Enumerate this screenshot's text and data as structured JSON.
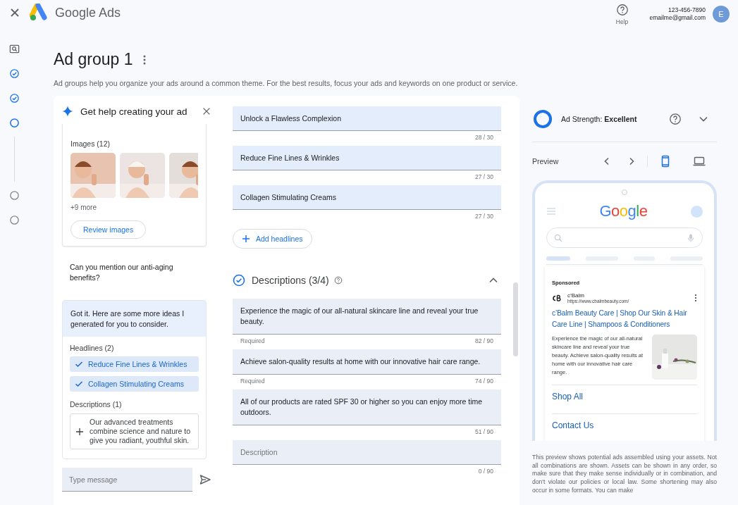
{
  "top_bar": {
    "product": "Google Ads",
    "help": "Help",
    "phone": "123-456-7890",
    "email": "emailme@gmail.com",
    "avatar": "E"
  },
  "steps": [
    {
      "kind": "preview"
    },
    {
      "kind": "done"
    },
    {
      "kind": "done"
    },
    {
      "kind": "current"
    },
    {
      "kind": "todo"
    },
    {
      "kind": "todo"
    }
  ],
  "page": {
    "title": "Ad group 1",
    "description": "Ad groups help you organize your ads around a common theme. For the best results, focus your ads and keywords on one product or service."
  },
  "assistant": {
    "title": "Get help creating your ad",
    "images_label": "Images (12)",
    "images": [
      {
        "kind": "picture"
      },
      {
        "kind": "picture"
      },
      {
        "kind": "picture"
      }
    ],
    "more": "+9 more",
    "review_button": "Review images",
    "user_message": "Can you mention our anti-aging benefits?",
    "reply": {
      "text": "Got it. Here are some more ideas I generated for you to consider.",
      "headlines_label": "Headlines (2)",
      "headlines": [
        {
          "text": "Reduce Fine Lines & Wrinkles",
          "checked": true
        },
        {
          "text": "Collagen Stimulating Creams",
          "checked": true
        }
      ],
      "descriptions_label": "Descriptions (1)",
      "descriptions": [
        {
          "text": "Our advanced treatments combine science and nature to give you radiant, youthful skin.",
          "added": false
        }
      ]
    },
    "input": {
      "placeholder": "Type message"
    }
  },
  "headlines": [
    {
      "value": "Unlock a Flawless Complexion",
      "counter": "28 / 30"
    },
    {
      "value": "Reduce Fine Lines & Wrinkles",
      "counter": "27 / 30"
    },
    {
      "value": "Collagen Stimulating Creams",
      "counter": "27 / 30"
    }
  ],
  "add_headlines": "Add headlines",
  "descriptions_section": {
    "title": "Descriptions (3/4)",
    "complete": true,
    "expanded": true,
    "fields": [
      {
        "value": "Experience the magic of our all-natural skincare line and reveal your true beauty.",
        "helper": "Required",
        "counter": "82 / 90"
      },
      {
        "value": "Achieve salon-quality results at home with our innovative hair care range.",
        "helper": "Required",
        "counter": "74 / 90"
      },
      {
        "value": "All of our products are rated SPF 30 or higher so you can enjoy more time outdoors.",
        "counter": "51 / 90"
      },
      {
        "placeholder": "Description",
        "counter": "0 / 90"
      }
    ]
  },
  "ad_strength": {
    "label": "Ad Strength: **Excellent**",
    "level": 1
  },
  "preview": {
    "label": "Preview",
    "devices": [
      {
        "kind": "mobile",
        "selected": true
      },
      {
        "kind": "desktop",
        "selected": false
      }
    ],
    "search_logo": "Google",
    "ad": {
      "sponsored": "Sponsored",
      "advertiser": "c’Balm",
      "url": "https://www.cbalmbeauty.com/",
      "headline": "c’Balm Beauty Care | Shop Our Skin & Hair Care Line | Shampoos & Conditioners",
      "description": "Experience the magic of our all-natural skincare line and reveal your true beauty. Achieve salon-quality results at home with our innovative hair care range.",
      "image": {
        "kind": "picture"
      },
      "sitelinks": [
        "Shop All",
        "Contact Us"
      ]
    },
    "disclaimer": "This preview shows potential ads assembled using your assets. Not all combinations are shown. Assets can be shown in any order, so make sure that they make sense individually or in combination, and don't violate our policies or local law. Some shortening may also occur in some formats. You can make"
  }
}
